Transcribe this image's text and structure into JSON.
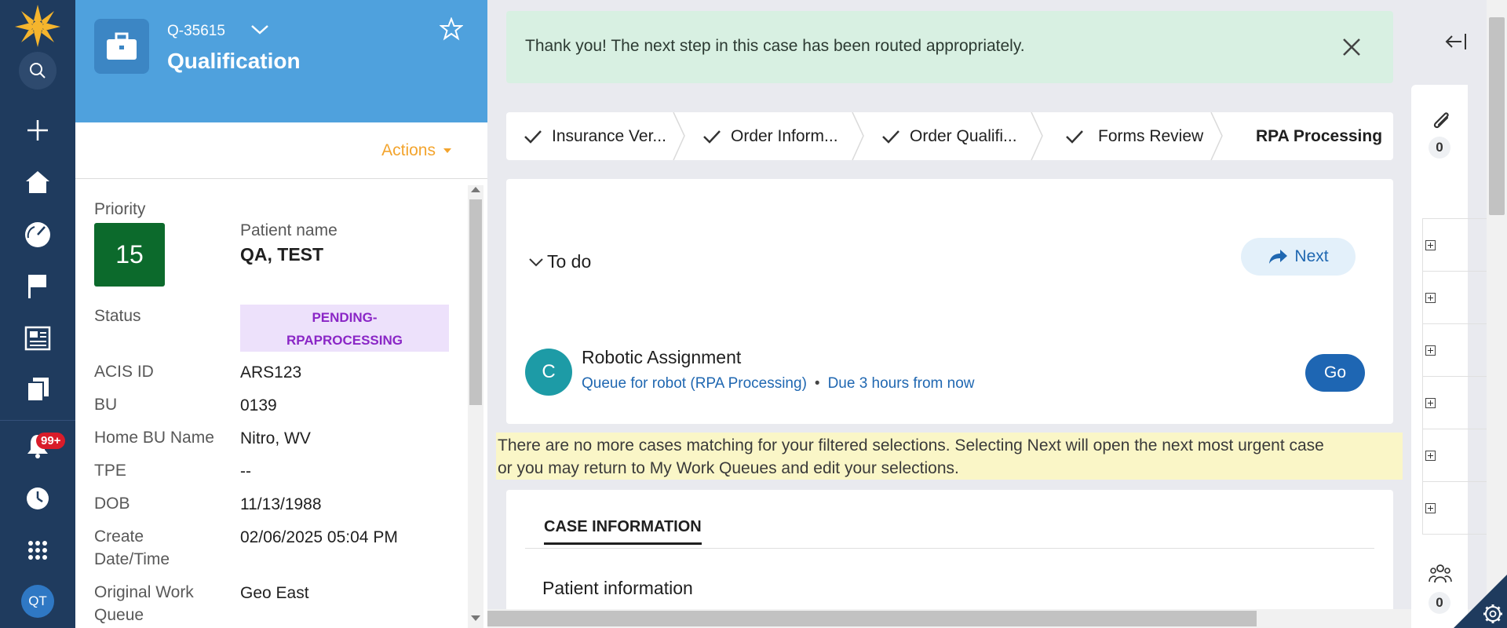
{
  "nav": {
    "notification_count": "99+",
    "user_initials": "QT"
  },
  "case": {
    "id": "Q-35615",
    "title": "Qualification",
    "actions_label": "Actions"
  },
  "details": {
    "priority_label": "Priority",
    "priority_value": "15",
    "patient_name_label": "Patient name",
    "patient_name_value": "QA, TEST",
    "status_label": "Status",
    "status_value_line1": "PENDING-",
    "status_value_line2": "RPAPROCESSING",
    "acis_id_label": "ACIS ID",
    "acis_id_value": "ARS123",
    "bu_label": "BU",
    "bu_value": "0139",
    "home_bu_label": "Home BU Name",
    "home_bu_value": "Nitro, WV",
    "tpe_label": "TPE",
    "tpe_value": "--",
    "dob_label": "DOB",
    "dob_value": "11/13/1988",
    "create_label_line1": "Create",
    "create_label_line2": "Date/Time",
    "create_value": "02/06/2025 05:04 PM",
    "owq_label_line1": "Original Work",
    "owq_label_line2": "Queue",
    "owq_value": "Geo East"
  },
  "banner": {
    "message": "Thank you! The next step in this case has been routed appropriately."
  },
  "stages": [
    {
      "label": "Insurance Ver..."
    },
    {
      "label": "Order Inform..."
    },
    {
      "label": "Order Qualifi..."
    },
    {
      "label": "Forms Review"
    },
    {
      "label": "RPA Processing"
    }
  ],
  "todo": {
    "title": "To do",
    "next_label": "Next",
    "assignment_initial": "C",
    "assignment_title": "Robotic Assignment",
    "assignment_queue": "Queue for robot (RPA Processing)",
    "assignment_dot": "•",
    "assignment_due": "Due 3 hours from now",
    "go_label": "Go"
  },
  "notice": {
    "line1": "There are no more cases matching for your filtered selections. Selecting Next will open the next most urgent case",
    "line2": "or you may return to My Work Queues and edit your selections."
  },
  "case_info": {
    "tab_label": "CASE INFORMATION",
    "section_title": "Patient information"
  },
  "utility": {
    "attachments_count": "0",
    "followers_count": "0"
  },
  "colors": {
    "rail": "#1f3b5e",
    "header": "#4fa1dd",
    "priority": "#0c6a2c",
    "accent": "#f3a42d",
    "link": "#1f67b1",
    "status_bg": "#ede1fb",
    "status_text": "#8a26c6",
    "banner_bg": "#d8f0e2",
    "notice_bg": "#faf6c7"
  }
}
